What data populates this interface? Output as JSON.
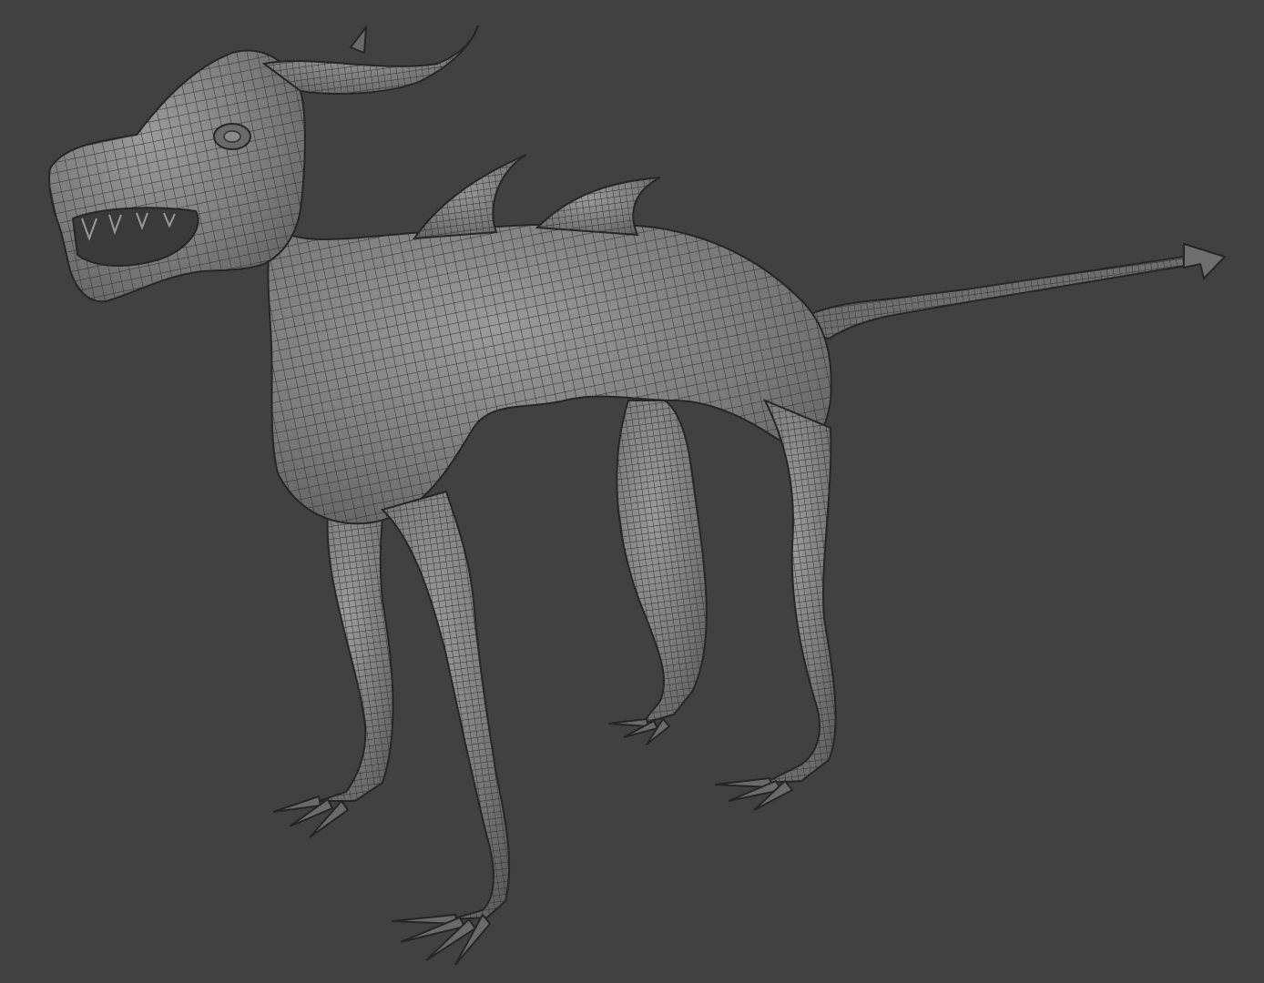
{
  "viewport": {
    "background_color": "#414141",
    "mesh_fill_color": "#7d7d7d",
    "mesh_wire_color": "#2f2f2f",
    "mesh_outline_color": "#262626",
    "display_mode": "wireframe-on-shaded"
  },
  "model": {
    "type": "quadruped creature",
    "parts": [
      "head",
      "horn",
      "horn-spike",
      "jaw",
      "eye",
      "dorsal-spike-1",
      "dorsal-spike-2",
      "body",
      "tail",
      "tail-arrowhead",
      "front-leg-near",
      "front-leg-far",
      "hind-leg-near",
      "hind-leg-far",
      "claws"
    ]
  }
}
